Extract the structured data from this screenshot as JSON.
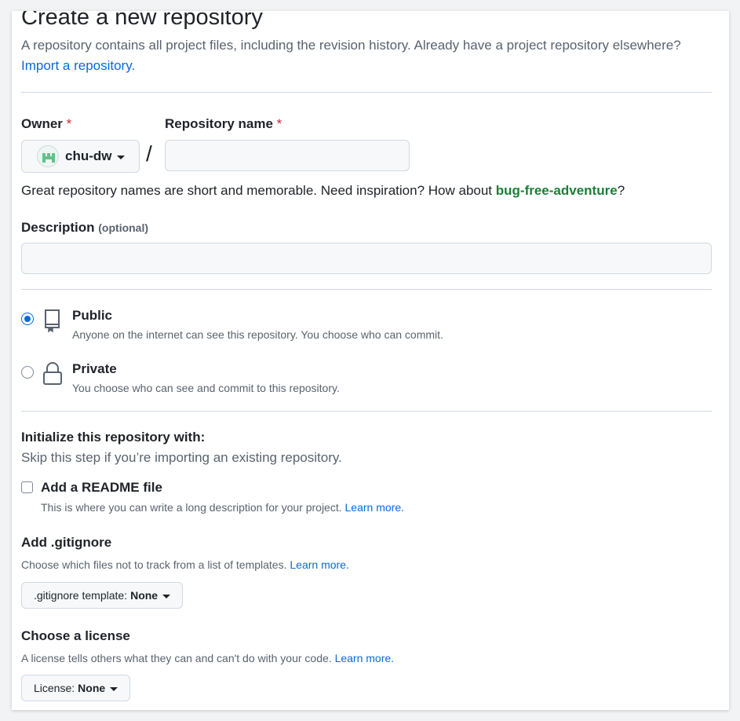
{
  "page": {
    "title": "Create a new repository",
    "subtitle": "A repository contains all project files, including the revision history. Already have a project repository elsewhere?",
    "import_link": "Import a repository."
  },
  "owner": {
    "label": "Owner",
    "required_mark": "*",
    "value": "chu-dw",
    "avatar_icon": "identicon-avatar"
  },
  "repo_name": {
    "label": "Repository name",
    "required_mark": "*",
    "value": "",
    "separator": "/"
  },
  "name_hint": {
    "text": "Great repository names are short and memorable. Need inspiration? How about ",
    "suggestion": "bug-free-adventure",
    "end": "?"
  },
  "description": {
    "label": "Description",
    "optional": "(optional)",
    "value": ""
  },
  "visibility": {
    "selected": "public",
    "options": [
      {
        "id": "public",
        "title": "Public",
        "desc": "Anyone on the internet can see this repository. You choose who can commit.",
        "icon": "repo-icon"
      },
      {
        "id": "private",
        "title": "Private",
        "desc": "You choose who can see and commit to this repository.",
        "icon": "lock-icon"
      }
    ]
  },
  "init": {
    "title": "Initialize this repository with:",
    "subtitle": "Skip this step if you’re importing an existing repository.",
    "readme": {
      "label": "Add a README file",
      "checked": false,
      "desc": "This is where you can write a long description for your project.",
      "learn_more": "Learn more."
    }
  },
  "gitignore": {
    "title": "Add .gitignore",
    "desc": "Choose which files not to track from a list of templates.",
    "learn_more": "Learn more.",
    "select_prefix": ".gitignore template:",
    "select_value": "None"
  },
  "license": {
    "title": "Choose a license",
    "desc": "A license tells others what they can and can't do with your code.",
    "learn_more": "Learn more.",
    "select_prefix": "License:",
    "select_value": "None"
  },
  "colors": {
    "link": "#0969da",
    "suggestion": "#1a7f37",
    "required": "#d1242f",
    "border": "#d1d9e0",
    "input_bg": "#f6f8fa"
  }
}
